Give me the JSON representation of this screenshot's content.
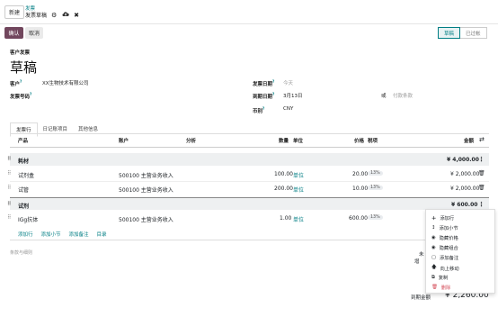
{
  "header": {
    "new_button": "新建",
    "breadcrumb_parent": "发票",
    "breadcrumb_current": "发票草稿"
  },
  "actions": {
    "confirm": "确认",
    "cancel": "取消"
  },
  "status": {
    "draft": "草稿",
    "posted": "已过帐"
  },
  "form": {
    "doc_type": "客户发票",
    "title": "草稿",
    "customer_label": "客户",
    "customer_value": "XX生物技术有限公司",
    "ref_label": "发票号码",
    "invoice_date_label": "发票日期",
    "invoice_date_placeholder": "今天",
    "due_date_label": "到期日期",
    "due_date_value": "3月13日",
    "or_label": "或",
    "payment_terms_placeholder": "付款条款",
    "currency_label": "币别",
    "currency_value": "CNY"
  },
  "tabs": [
    "发票行",
    "日记账项目",
    "其他信息"
  ],
  "table": {
    "headers": {
      "product": "产品",
      "account": "账户",
      "analytic": "分析",
      "quantity": "数量",
      "unit": "单位",
      "price": "价格",
      "taxes": "税项",
      "amount": "金额"
    },
    "sections": [
      {
        "name": "耗材",
        "total": "¥ 4,000.00"
      },
      {
        "name": "试剂",
        "total": "¥ 600.00"
      }
    ],
    "lines": [
      {
        "product": "试剂盒",
        "account": "500100 主营业务收入",
        "quantity": "100.00",
        "unit": "单位",
        "price": "20.00",
        "tax": "13%",
        "amount": "¥ 2,000.00"
      },
      {
        "product": "试管",
        "account": "500100 主营业务收入",
        "quantity": "200.00",
        "unit": "单位",
        "price": "10.00",
        "tax": "13%",
        "amount": "¥ 2,000.00"
      },
      {
        "product": "IGg抗体",
        "account": "500100 主营业务收入",
        "quantity": "1.00",
        "unit": "单位",
        "price": "600.00",
        "tax": "13%",
        "amount": ""
      }
    ],
    "add_links": [
      "添加行",
      "添加小节",
      "添加备注",
      "目录"
    ]
  },
  "terms_placeholder": "条款与细则",
  "footer": {
    "partial_label_1": "未",
    "partial_label_2": "增",
    "total_label": "到期金额",
    "total_value": "¥ 2,260.00"
  },
  "context_menu": [
    {
      "icon": "plus-icon",
      "label": "添加行"
    },
    {
      "icon": "section-icon",
      "label": "添加小节"
    },
    {
      "icon": "eye-icon",
      "label": "隐藏价格"
    },
    {
      "icon": "eye-icon",
      "label": "隐藏组合"
    },
    {
      "icon": "note-icon",
      "label": "添加备注"
    },
    {
      "icon": "arrow-up-icon",
      "label": "向上移动"
    },
    {
      "icon": "copy-icon",
      "label": "复制"
    },
    {
      "icon": "trash-icon",
      "label": "删除"
    }
  ],
  "colors": {
    "primary": "#71465d",
    "accent": "#017e84",
    "danger": "#d44c59"
  }
}
